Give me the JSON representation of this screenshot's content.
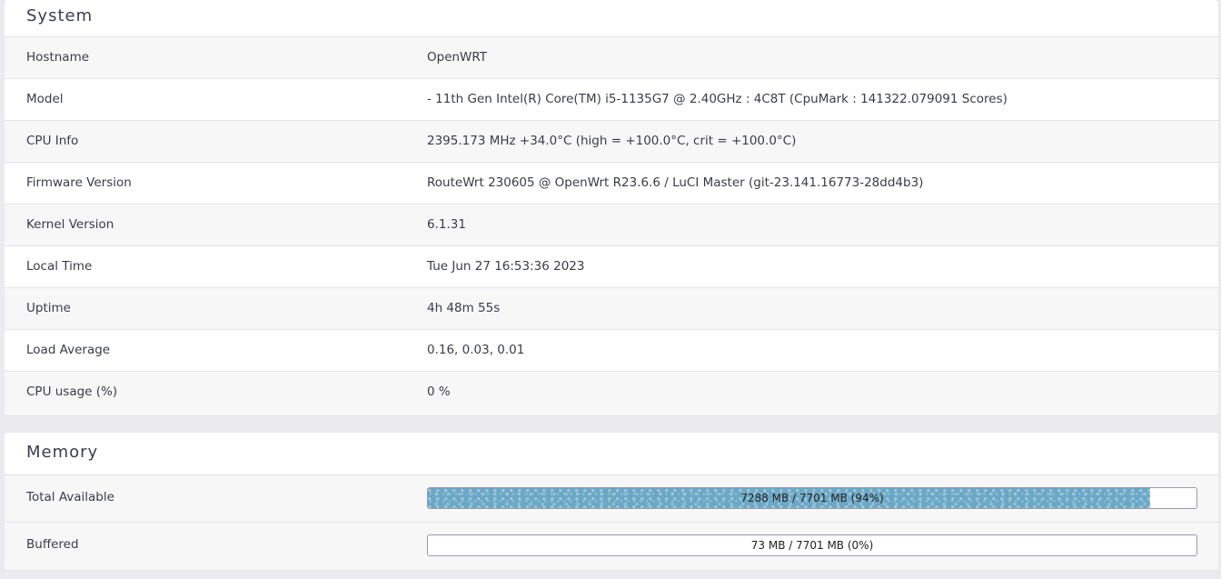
{
  "system": {
    "title": "System",
    "rows": [
      {
        "label": "Hostname",
        "value": "OpenWRT"
      },
      {
        "label": "Model",
        "value": "- 11th Gen Intel(R) Core(TM) i5-1135G7 @ 2.40GHz : 4C8T (CpuMark : 141322.079091 Scores)"
      },
      {
        "label": "CPU Info",
        "value": "2395.173 MHz +34.0°C (high = +100.0°C, crit = +100.0°C)"
      },
      {
        "label": "Firmware Version",
        "value": "RouteWrt 230605 @ OpenWrt R23.6.6 / LuCI Master (git-23.141.16773-28dd4b3)"
      },
      {
        "label": "Kernel Version",
        "value": "6.1.31"
      },
      {
        "label": "Local Time",
        "value": "Tue Jun 27 16:53:36 2023"
      },
      {
        "label": "Uptime",
        "value": "4h 48m 55s"
      },
      {
        "label": "Load Average",
        "value": "0.16, 0.03, 0.01"
      },
      {
        "label": "CPU usage (%)",
        "value": "0 %"
      }
    ]
  },
  "memory": {
    "title": "Memory",
    "rows": [
      {
        "label": "Total Available",
        "bar_text": "7288 MB / 7701 MB (94%)",
        "fraction": 0.94
      },
      {
        "label": "Buffered",
        "bar_text": "73 MB / 7701 MB (0%)",
        "fraction": 0.0
      }
    ]
  },
  "colors": {
    "bar_fill": "#6aa8c6",
    "background": "#ebebef",
    "panel": "#ffffff"
  }
}
